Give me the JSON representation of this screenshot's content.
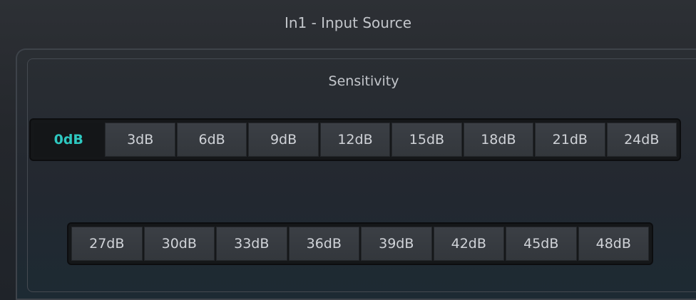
{
  "window": {
    "title": "In1 - Input Source"
  },
  "sensitivity": {
    "title": "Sensitivity",
    "selected": "0dB",
    "row1": [
      {
        "label": "0dB",
        "selected": true
      },
      {
        "label": "3dB",
        "selected": false
      },
      {
        "label": "6dB",
        "selected": false
      },
      {
        "label": "9dB",
        "selected": false
      },
      {
        "label": "12dB",
        "selected": false
      },
      {
        "label": "15dB",
        "selected": false
      },
      {
        "label": "18dB",
        "selected": false
      },
      {
        "label": "21dB",
        "selected": false
      },
      {
        "label": "24dB",
        "selected": false
      }
    ],
    "row2": [
      {
        "label": "27dB",
        "selected": false
      },
      {
        "label": "30dB",
        "selected": false
      },
      {
        "label": "33dB",
        "selected": false
      },
      {
        "label": "36dB",
        "selected": false
      },
      {
        "label": "39dB",
        "selected": false
      },
      {
        "label": "42dB",
        "selected": false
      },
      {
        "label": "45dB",
        "selected": false
      },
      {
        "label": "48dB",
        "selected": false
      }
    ]
  },
  "colors": {
    "accent": "#2ec8c0",
    "background": "#26292e",
    "button": "#383c42",
    "button_selected": "#141618",
    "text": "#d0d3d8"
  }
}
